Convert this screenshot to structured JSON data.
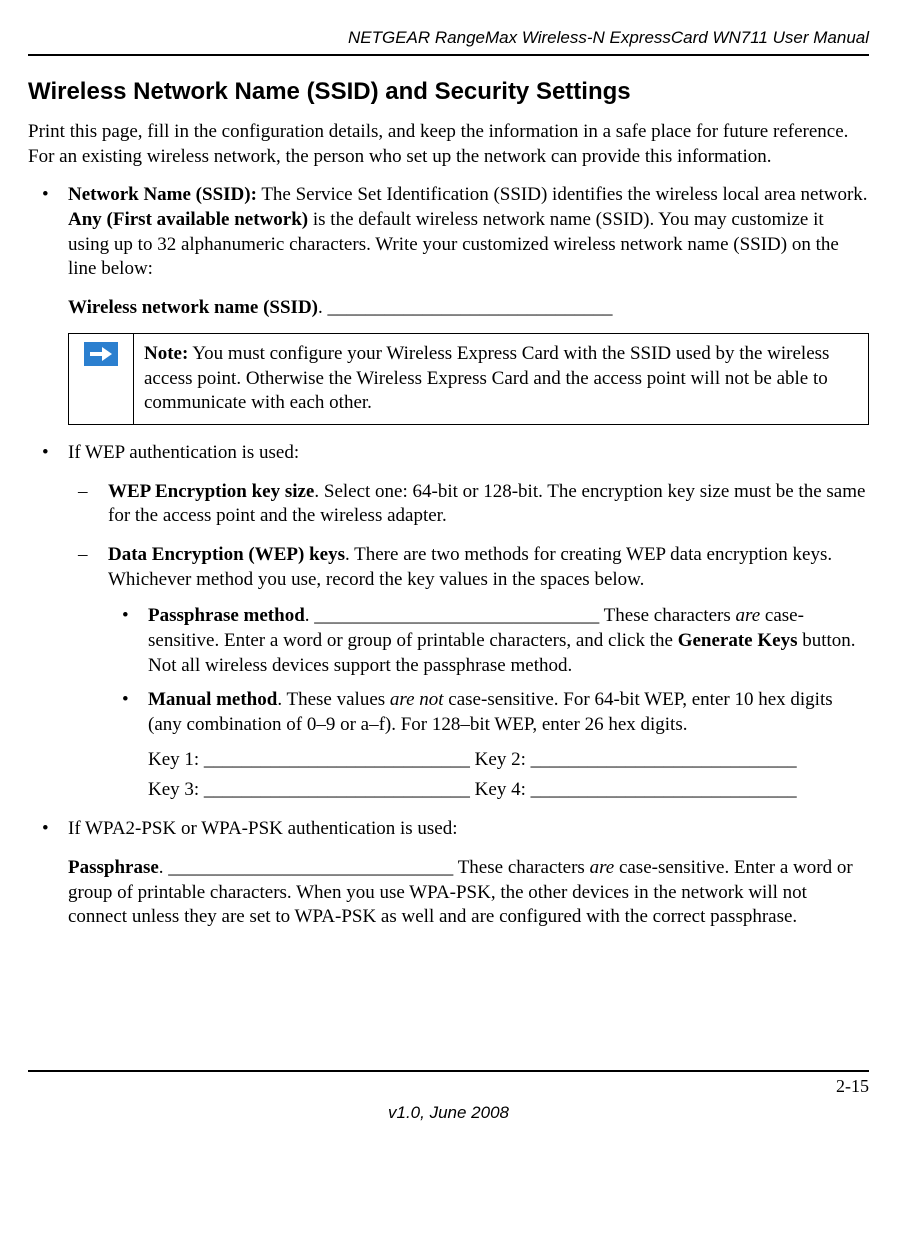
{
  "header": {
    "running_title": "NETGEAR RangeMax Wireless-N ExpressCard WN711 User Manual"
  },
  "section": {
    "title": "Wireless Network Name (SSID) and Security Settings",
    "intro": "Print this page, fill in the configuration details, and keep the information in a safe place for future reference. For an existing wireless network, the person who set up the network can provide this information."
  },
  "bullet1": {
    "label": "Network Name (SSID):",
    "text_after_label": " The Service Set Identification (SSID) identifies the wireless local area network. ",
    "bold2": "Any (First available network)",
    "text_after_bold2": " is the default wireless network name (SSID). You may customize it using up to 32 alphanumeric characters. Write your customized wireless network name (SSID) on the line below:",
    "ssid_line_label": "Wireless network name (SSID)",
    "ssid_line_blank": ". ______________________________"
  },
  "note": {
    "label": "Note:",
    "text": " You must configure your Wireless Express Card with the SSID used by the wireless access point. Otherwise the Wireless Express Card and the access point will not be able to communicate with each other."
  },
  "bullet2": {
    "lead": "If WEP authentication is used:",
    "dash1": {
      "label": "WEP Encryption key size",
      "rest": ". Select one: 64-bit or 128-bit. The encryption key size must be the same for the access point and the wireless adapter."
    },
    "dash2": {
      "label": "Data Encryption (WEP) keys",
      "rest": ". There are two methods for creating WEP data encryption keys. Whichever method you use, record the key values in the spaces below."
    },
    "inner1": {
      "label": "Passphrase method",
      "dot": ". ",
      "blank": "______________________________",
      "tail1": " These characters ",
      "em": "are",
      "tail2": " case-sensitive. Enter a word or group of printable characters, and click the ",
      "bold": "Generate Keys",
      "tail3": " button. Not all wireless devices support the passphrase method."
    },
    "inner2": {
      "label": "Manual method",
      "dot": ". These values ",
      "em": "are not",
      "tail": " case-sensitive. For 64-bit WEP, enter 10 hex digits (any combination of 0–9 or a–f). For 128–bit WEP, enter 26 hex digits."
    },
    "keys_line1": "Key 1: ____________________________ Key 2: ____________________________",
    "keys_line2": "Key 3: ____________________________ Key 4: ____________________________"
  },
  "bullet3": {
    "lead": "If WPA2-PSK or WPA-PSK authentication is used:",
    "pass_label": "Passphrase",
    "pass_dot": ". ",
    "pass_blank": "______________________________",
    "pass_tail1": " These characters ",
    "pass_em": "are",
    "pass_tail2": " case-sensitive. Enter a word or group of printable characters. When you use WPA-PSK, the other devices in the network will not connect unless they are set to WPA-PSK as well and are configured with the correct passphrase."
  },
  "footer": {
    "page_number": "2-15",
    "version": "v1.0, June 2008"
  }
}
